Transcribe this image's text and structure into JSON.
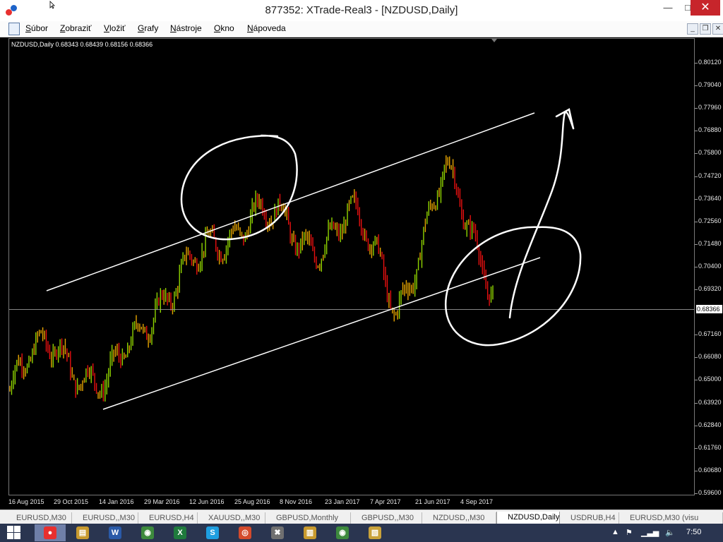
{
  "window": {
    "title": "877352: XTrade-Real3 - [NZDUSD,Daily]",
    "min_glyph": "—",
    "max_glyph": "□",
    "close_glyph": "✕"
  },
  "menu": {
    "items": [
      {
        "first": "S",
        "rest": "úbor"
      },
      {
        "first": "Z",
        "rest": "obraziť"
      },
      {
        "first": "V",
        "rest": "ložiť"
      },
      {
        "first": "G",
        "rest": "rafy"
      },
      {
        "first": "N",
        "rest": "ástroje"
      },
      {
        "first": "O",
        "rest": "kno"
      },
      {
        "first": "N",
        "rest": "ápoveda"
      }
    ],
    "mdi_min": "_",
    "mdi_restore": "❐",
    "mdi_close": "✕"
  },
  "chart": {
    "legend": "NZDUSD,Daily  0.68343 0.68439 0.68156 0.68366",
    "current_price": "0.68366",
    "price_labels": [
      "0.80120",
      "0.79040",
      "0.77960",
      "0.76880",
      "0.75800",
      "0.74720",
      "0.73640",
      "0.72560",
      "0.71480",
      "0.70400",
      "0.69320",
      "0.67160",
      "0.66080",
      "0.65000",
      "0.63920",
      "0.62840",
      "0.61760",
      "0.60680",
      "0.59600"
    ],
    "date_labels": [
      "16 Aug 2015",
      "29 Oct 2015",
      "14 Jan 2016",
      "29 Mar 2016",
      "12 Jun 2016",
      "25 Aug 2016",
      "8 Nov 2016",
      "23 Jan 2017",
      "7 Apr 2017",
      "21 Jun 2017",
      "4 Sep 2017"
    ],
    "colors": {
      "up": "#8fd400",
      "mid": "#e6a400",
      "down": "#e81010",
      "channel": "#ffffff",
      "annotation": "#ffffff"
    }
  },
  "chart_data": {
    "type": "line",
    "title": "NZDUSD,Daily",
    "x": [
      "16 Aug 2015",
      "29 Oct 2015",
      "14 Jan 2016",
      "29 Mar 2016",
      "12 Jun 2016",
      "25 Aug 2016",
      "8 Nov 2016",
      "23 Jan 2017",
      "7 Apr 2017",
      "21 Jun 2017",
      "4 Sep 2017"
    ],
    "series": [
      {
        "values": [
          0.645,
          0.67,
          0.642,
          0.69,
          0.705,
          0.735,
          0.712,
          0.73,
          0.687,
          0.745,
          0.7
        ]
      }
    ],
    "ylim": [
      0.596,
      0.8066
    ],
    "grid": false,
    "last": {
      "open": 0.68343,
      "high": 0.68439,
      "low": 0.68156,
      "close": 0.68366
    }
  },
  "tabs": [
    {
      "label": "EURUSD,M30",
      "active": false
    },
    {
      "label": "EURUSD,,M30",
      "active": false
    },
    {
      "label": "EURUSD,H4",
      "active": false
    },
    {
      "label": "XAUUSD,,M30",
      "active": false
    },
    {
      "label": "GBPUSD,Monthly",
      "active": false
    },
    {
      "label": "GBPUSD,,M30",
      "active": false
    },
    {
      "label": "NZDUSD,,M30",
      "active": false
    },
    {
      "label": "NZDUSD,Daily",
      "active": true
    },
    {
      "label": "USDRUB,H4",
      "active": false
    },
    {
      "label": "EURUSD,M30 (visu",
      "active": false
    }
  ],
  "taskbar": {
    "apps": [
      {
        "name": "xtrade",
        "glyph": "●",
        "color": "#e8302f"
      },
      {
        "name": "folder",
        "glyph": "▤",
        "color": "#c89a2e"
      },
      {
        "name": "word",
        "glyph": "W",
        "color": "#2a5aa8"
      },
      {
        "name": "globe",
        "glyph": "◉",
        "color": "#3d8a3d"
      },
      {
        "name": "excel",
        "glyph": "X",
        "color": "#1f7a3d"
      },
      {
        "name": "skype",
        "glyph": "S",
        "color": "#1e9ee0"
      },
      {
        "name": "chrome",
        "glyph": "◎",
        "color": "#d44a2c"
      },
      {
        "name": "app-x",
        "glyph": "✖",
        "color": "#707070"
      },
      {
        "name": "explorer",
        "glyph": "▥",
        "color": "#c89a2e"
      },
      {
        "name": "globe2",
        "glyph": "◉",
        "color": "#3d8a3d"
      },
      {
        "name": "photo",
        "glyph": "▧",
        "color": "#c9a23a"
      }
    ],
    "time": "7:50"
  }
}
